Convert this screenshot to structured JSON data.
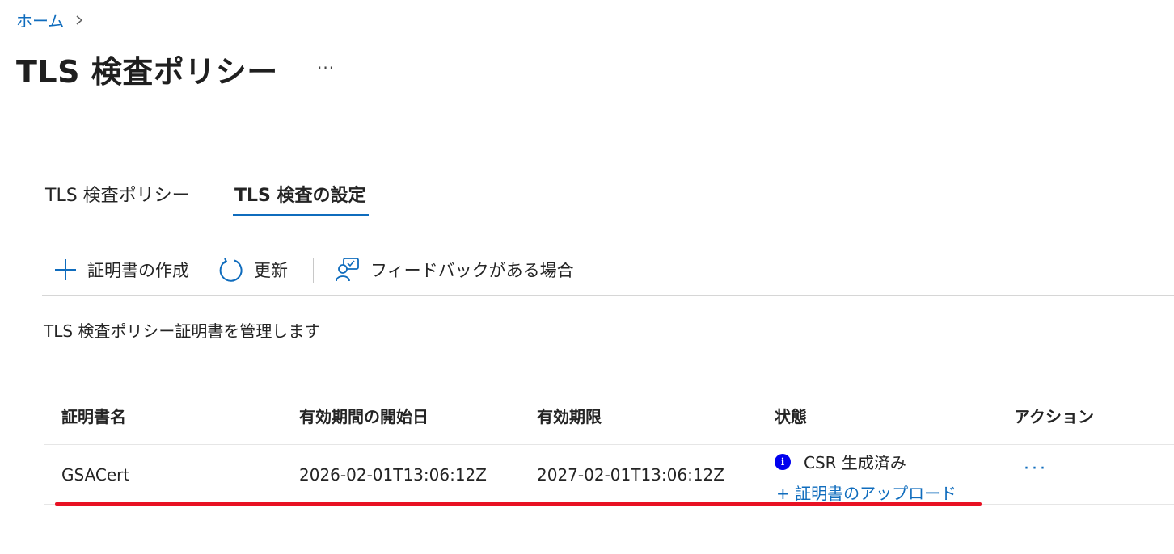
{
  "breadcrumb": {
    "home": "ホーム"
  },
  "page": {
    "title": "TLS 検査ポリシー",
    "more": "···"
  },
  "tabs": [
    {
      "label": "TLS 検査ポリシー",
      "active": false
    },
    {
      "label": "TLS 検査の設定",
      "active": true
    }
  ],
  "toolbar": {
    "create_label": "証明書の作成",
    "refresh_label": "更新",
    "feedback_label": "フィードバックがある場合"
  },
  "description": "TLS 検査ポリシー証明書を管理します",
  "table": {
    "columns": [
      "証明書名",
      "有効期間の開始日",
      "有効期限",
      "状態",
      "アクション"
    ],
    "rows": [
      {
        "name": "GSACert",
        "start": "2026-02-01T13:06:12Z",
        "expiry": "2027-02-01T13:06:12Z",
        "status": "CSR 生成済み",
        "status_icon": "info-icon",
        "upload_link": "+ 証明書のアップロード",
        "actions": "···"
      }
    ]
  },
  "colors": {
    "accent": "#0f6cbd",
    "highlight_underline": "#e81123",
    "info_icon": "#0000ee"
  }
}
